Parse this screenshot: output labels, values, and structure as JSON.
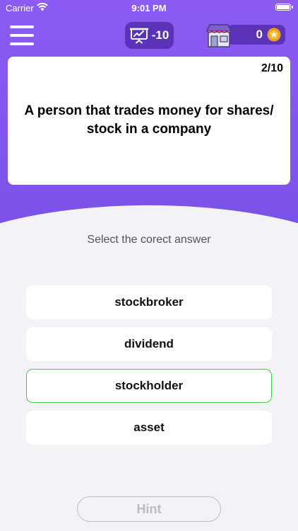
{
  "status_bar": {
    "carrier": "Carrier",
    "time": "9:01 PM"
  },
  "header": {
    "score": "-10",
    "coins": "0"
  },
  "question": {
    "progress": "2/10",
    "text": "A person that trades money for shares/ stock in a company"
  },
  "instruction": "Select the corect answer",
  "answers": [
    {
      "label": "stockbroker",
      "selected": false
    },
    {
      "label": "dividend",
      "selected": false
    },
    {
      "label": "stockholder",
      "selected": true
    },
    {
      "label": "asset",
      "selected": false
    }
  ],
  "hint_label": "Hint",
  "colors": {
    "accent": "#8c5cf2",
    "pill": "#5a33b9",
    "selected_border": "#3fd33f",
    "coin": "#f2a520"
  },
  "icons": {
    "menu": "hamburger-menu-icon",
    "score": "presentation-chart-icon",
    "store": "store-icon",
    "coin": "star-coin-icon"
  }
}
